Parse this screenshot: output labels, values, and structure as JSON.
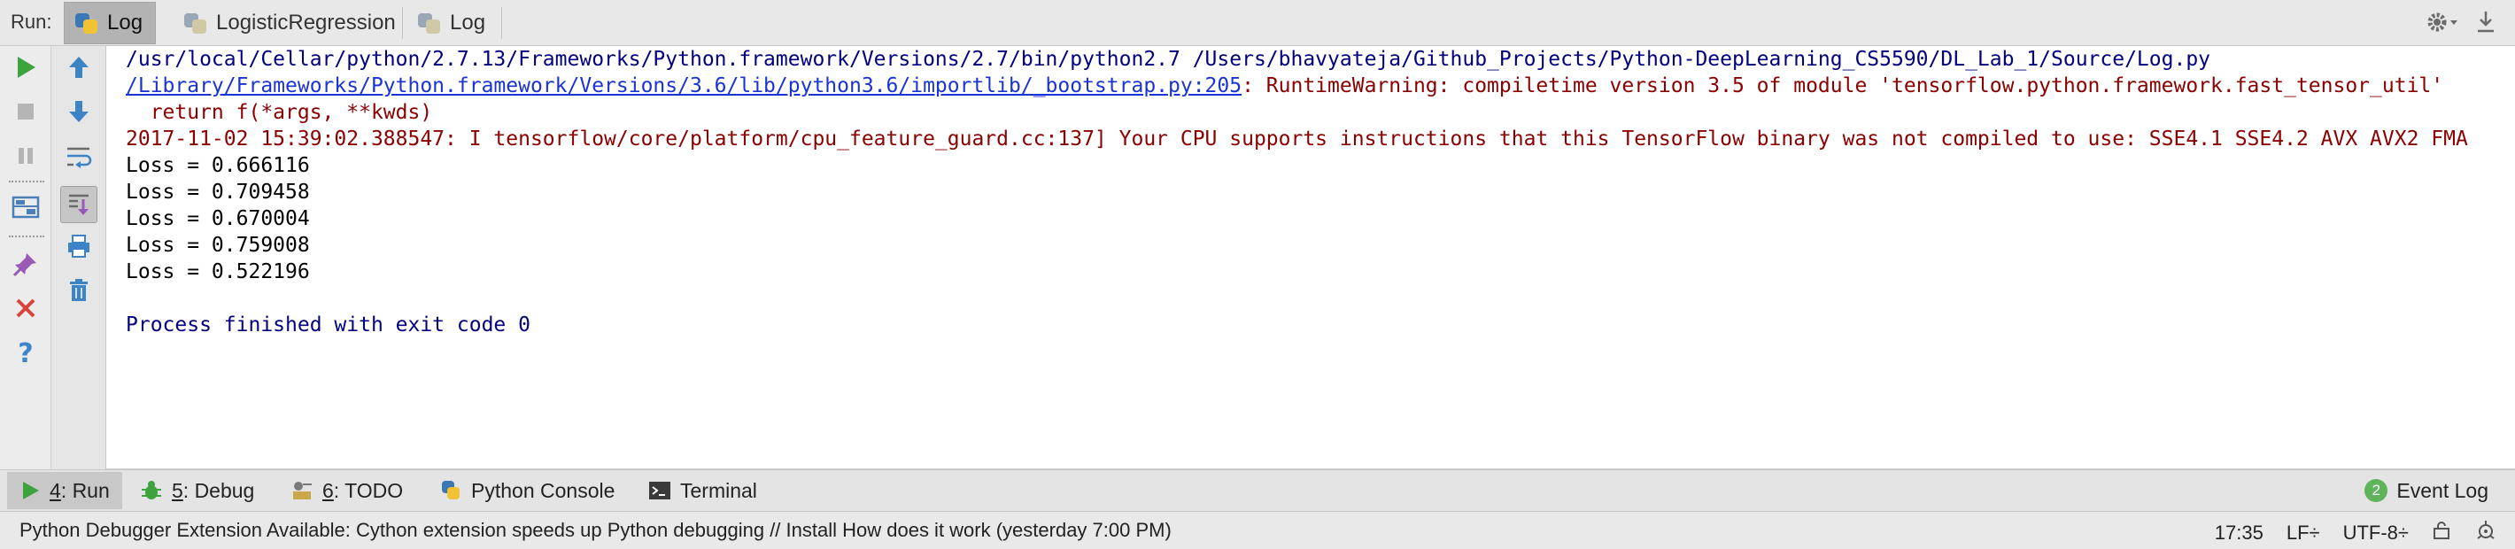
{
  "runbar": {
    "label": "Run:",
    "tabs": [
      {
        "label": "Log"
      },
      {
        "label": "LogisticRegression"
      },
      {
        "label": "Log"
      }
    ]
  },
  "console": {
    "cmd_line": "/usr/local/Cellar/python/2.7.13/Frameworks/Python.framework/Versions/2.7/bin/python2.7 /Users/bhavyateja/Github_Projects/Python-DeepLearning_CS5590/DL_Lab_1/Source/Log.py",
    "warning_link": "/Library/Frameworks/Python.framework/Versions/3.6/lib/python3.6/importlib/_bootstrap.py:205",
    "warning_text": ": RuntimeWarning: compiletime version 3.5 of module 'tensorflow.python.framework.fast_tensor_util'",
    "return_line": "  return f(*args, **kwds)",
    "cpu_line": "2017-11-02 15:39:02.388547: I tensorflow/core/platform/cpu_feature_guard.cc:137] Your CPU supports instructions that this TensorFlow binary was not compiled to use: SSE4.1 SSE4.2 AVX AVX2 FMA",
    "loss_lines": [
      "Loss = 0.666116",
      "Loss = 0.709458",
      "Loss = 0.670004",
      "Loss = 0.759008",
      "Loss = 0.522196"
    ],
    "process_line": "Process finished with exit code 0"
  },
  "bottom_tabs": [
    {
      "prefix": "4",
      "label": ": Run"
    },
    {
      "prefix": "5",
      "label": ": Debug"
    },
    {
      "prefix": "6",
      "label": ": TODO"
    },
    {
      "prefix": "",
      "label": "Python Console"
    },
    {
      "prefix": "",
      "label": "Terminal"
    }
  ],
  "event_log": {
    "count": "2",
    "label": "Event Log"
  },
  "status": {
    "message": "Python Debugger Extension Available: Cython extension speeds up Python debugging // Install How does it work (yesterday 7:00 PM)",
    "time": "17:35",
    "line_sep": "LF÷",
    "encoding": "UTF-8÷"
  },
  "colors": {
    "run_green": "#3da33d",
    "stop_grey": "#b5b5b5",
    "arrow_blue": "#3c84c6",
    "close_red": "#d9433a",
    "help_blue": "#3e86c9",
    "pin_purple": "#9b59b6",
    "link_blue": "#1a33d6",
    "error_red": "#8b0000",
    "output_navy": "#000080"
  }
}
